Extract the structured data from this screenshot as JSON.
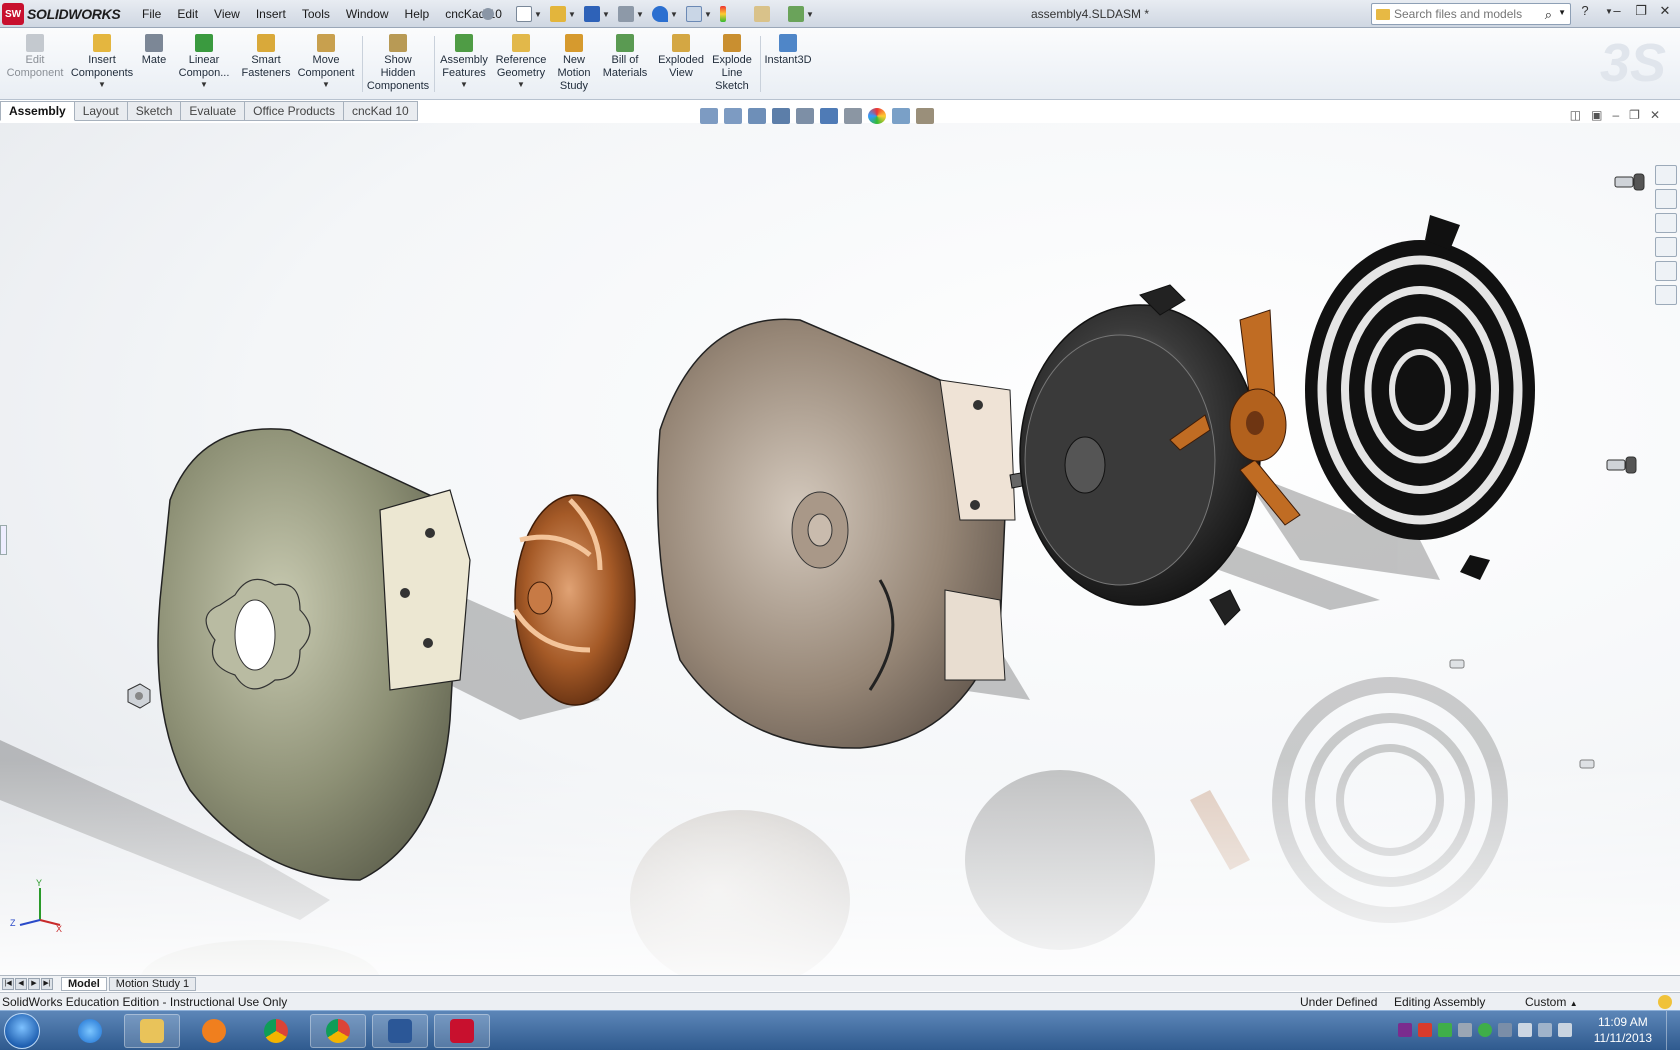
{
  "app": {
    "badge": "SW",
    "brand": "SOLIDWORKS",
    "document_title": "assembly4.SLDASM *"
  },
  "menu": [
    "File",
    "Edit",
    "View",
    "Insert",
    "Tools",
    "Window",
    "Help",
    "cncKad 10"
  ],
  "search": {
    "placeholder": "Search files and models"
  },
  "commands": [
    {
      "label1": "Edit",
      "label2": "Component",
      "label3": "",
      "icon": "edit-component-icon",
      "disabled": true
    },
    {
      "label1": "Insert",
      "label2": "Components",
      "label3": "",
      "icon": "insert-components-icon",
      "dropdown": true
    },
    {
      "label1": "Mate",
      "label2": "",
      "label3": "",
      "icon": "mate-icon"
    },
    {
      "label1": "Linear",
      "label2": "Compon...",
      "label3": "",
      "icon": "linear-pattern-icon",
      "dropdown": true
    },
    {
      "label1": "Smart",
      "label2": "Fasteners",
      "label3": "",
      "icon": "smart-fasteners-icon"
    },
    {
      "label1": "Move",
      "label2": "Component",
      "label3": "",
      "icon": "move-component-icon",
      "dropdown": true
    },
    {
      "label1": "Show",
      "label2": "Hidden",
      "label3": "Components",
      "icon": "show-hidden-icon"
    },
    {
      "label1": "Assembly",
      "label2": "Features",
      "label3": "",
      "icon": "assembly-features-icon",
      "dropdown": true
    },
    {
      "label1": "Reference",
      "label2": "Geometry",
      "label3": "",
      "icon": "reference-geometry-icon",
      "dropdown": true
    },
    {
      "label1": "New",
      "label2": "Motion",
      "label3": "Study",
      "icon": "motion-study-icon"
    },
    {
      "label1": "Bill of",
      "label2": "Materials",
      "label3": "",
      "icon": "bom-icon"
    },
    {
      "label1": "Exploded",
      "label2": "View",
      "label3": "",
      "icon": "exploded-view-icon"
    },
    {
      "label1": "Explode",
      "label2": "Line",
      "label3": "Sketch",
      "icon": "explode-line-icon"
    },
    {
      "label1": "Instant3D",
      "label2": "",
      "label3": "",
      "icon": "instant3d-icon"
    }
  ],
  "tabs": [
    "Assembly",
    "Layout",
    "Sketch",
    "Evaluate",
    "Office Products",
    "cncKad 10"
  ],
  "bottom_tabs": [
    "Model",
    "Motion Study 1"
  ],
  "status": {
    "edition": "SolidWorks Education Edition - Instructional Use Only",
    "definition": "Under Defined",
    "mode": "Editing Assembly",
    "units": "Custom"
  },
  "taskbar": {
    "time": "11:09 AM",
    "date": "11/11/2013",
    "apps": [
      "start-orb",
      "internet-explorer",
      "file-explorer",
      "media-player",
      "chrome",
      "chrome",
      "word",
      "solidworks"
    ]
  },
  "triad": {
    "x": "X",
    "y": "Y",
    "z": "Z"
  },
  "colors": {
    "brand_red": "#c8102e",
    "housing": "#8a8e74",
    "impeller": "#a0521e",
    "volute": "#8c7d6e",
    "motor": "#2a2a2a"
  }
}
